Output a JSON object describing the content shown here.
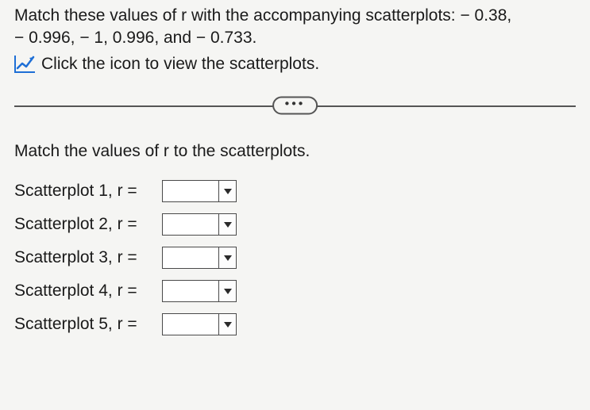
{
  "intro_line1": "Match these values of r with the accompanying scatterplots: − 0.38,",
  "intro_line2": "− 0.996, − 1, 0.996, and − 0.733.",
  "icon_text": "Click the icon to view the scatterplots.",
  "ellipsis": "•••",
  "instruction": "Match the values of r to the scatterplots.",
  "items": [
    {
      "label": "Scatterplot 1, r =",
      "value": ""
    },
    {
      "label": "Scatterplot 2, r =",
      "value": ""
    },
    {
      "label": "Scatterplot 3, r =",
      "value": ""
    },
    {
      "label": "Scatterplot 4, r =",
      "value": ""
    },
    {
      "label": "Scatterplot 5, r =",
      "value": ""
    }
  ]
}
